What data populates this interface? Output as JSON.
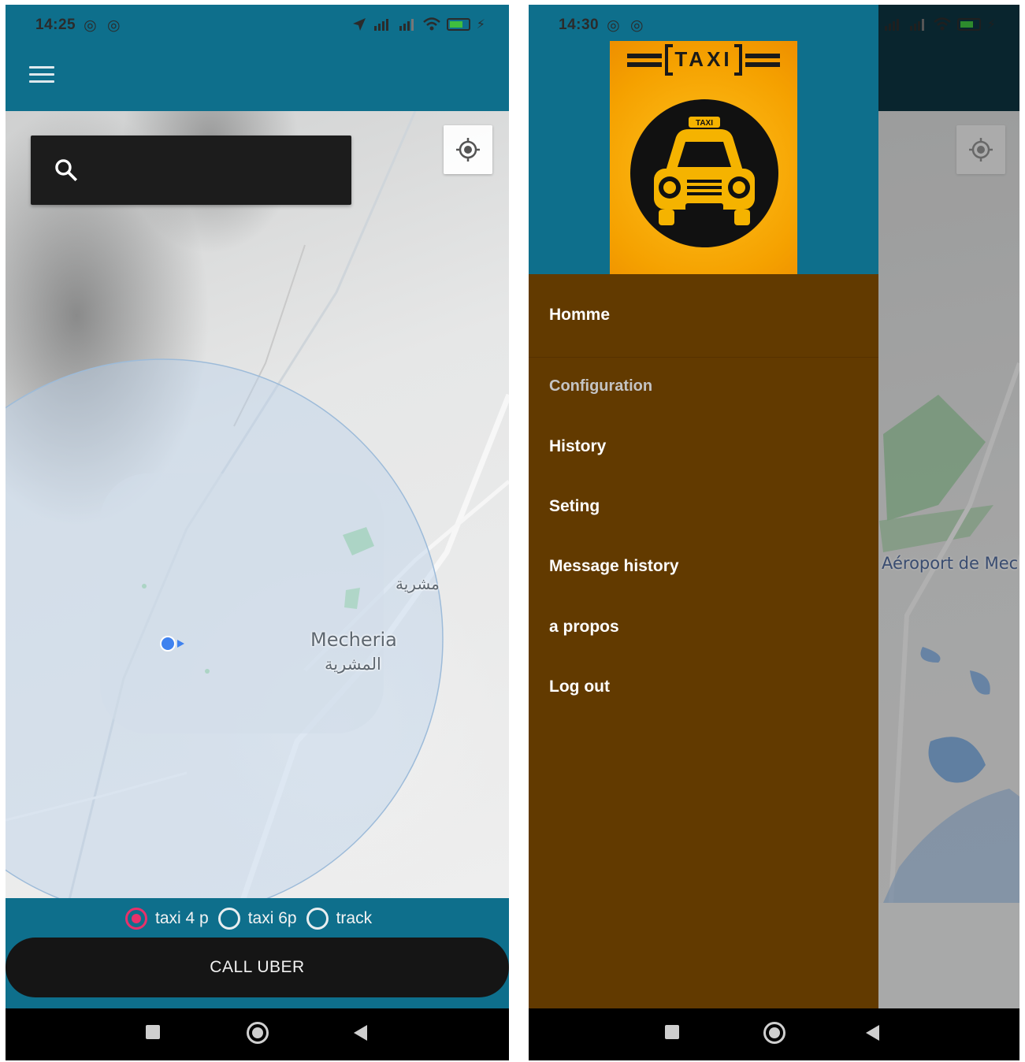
{
  "left_screen": {
    "status_bar": {
      "time": "14:25",
      "notif_icons": "◎ ◎"
    },
    "app_bar": {
      "menu_icon": "hamburger-icon"
    },
    "search": {
      "icon": "search-icon",
      "placeholder": ""
    },
    "map": {
      "labels": [
        "مشرية",
        "Mecheria",
        "المشرية"
      ],
      "search_radius_color": "#c9dbee",
      "my_location_color": "#4285f4"
    },
    "vehicle_options": [
      {
        "label": "taxi 4 p",
        "selected": true
      },
      {
        "label": "taxi 6p",
        "selected": false
      },
      {
        "label": "track",
        "selected": false
      }
    ],
    "call_button": "CALL UBER"
  },
  "right_screen": {
    "status_bar": {
      "time": "14:30",
      "notif_icons": "◎ ◎"
    },
    "drawer": {
      "logo_text": "TAXI",
      "logo_badge": "TAXI",
      "items": [
        {
          "label": "Homme"
        },
        {
          "section": "Configuration"
        },
        {
          "label": "History"
        },
        {
          "label": "Seting"
        },
        {
          "label": "Message history"
        },
        {
          "label": "a propos"
        },
        {
          "label": "Log out"
        }
      ]
    },
    "map": {
      "airport_label": "Aéroport de Mecheria"
    }
  },
  "colors": {
    "app_bar": "#0e6f8c",
    "drawer_bg": "#623a00",
    "radio_selected": "#e8316a",
    "call_button": "#151515",
    "logo_orange": "#f5a100"
  }
}
